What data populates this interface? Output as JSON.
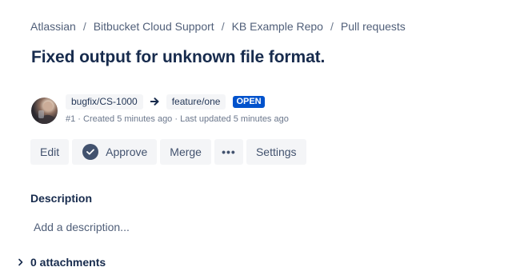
{
  "breadcrumbs": [
    "Atlassian",
    "Bitbucket Cloud Support",
    "KB Example Repo",
    "Pull requests"
  ],
  "breadcrumb_separator": "/",
  "pull_request": {
    "title": "Fixed output for unknown file format.",
    "source_branch": "bugfix/CS-1000",
    "destination_branch": "feature/one",
    "status": "OPEN",
    "meta": "#1 · Created 5 minutes ago · Last updated 5 minutes ago"
  },
  "actions": {
    "edit_label": "Edit",
    "approve_label": "Approve",
    "merge_label": "Merge",
    "more_label": "•••",
    "settings_label": "Settings"
  },
  "description": {
    "heading": "Description",
    "placeholder": "Add a description..."
  },
  "attachments": {
    "label": "0 attachments"
  },
  "icons": {
    "avatar": "user-avatar",
    "approve": "check-circle-icon",
    "more": "more-horizontal-icon",
    "attachments_toggle": "chevron-right-icon",
    "branch_arrow": "arrow-right-icon"
  },
  "colors": {
    "status_open": "#0052cc",
    "text_primary": "#172b4d",
    "button_bg": "#f4f5f7"
  }
}
